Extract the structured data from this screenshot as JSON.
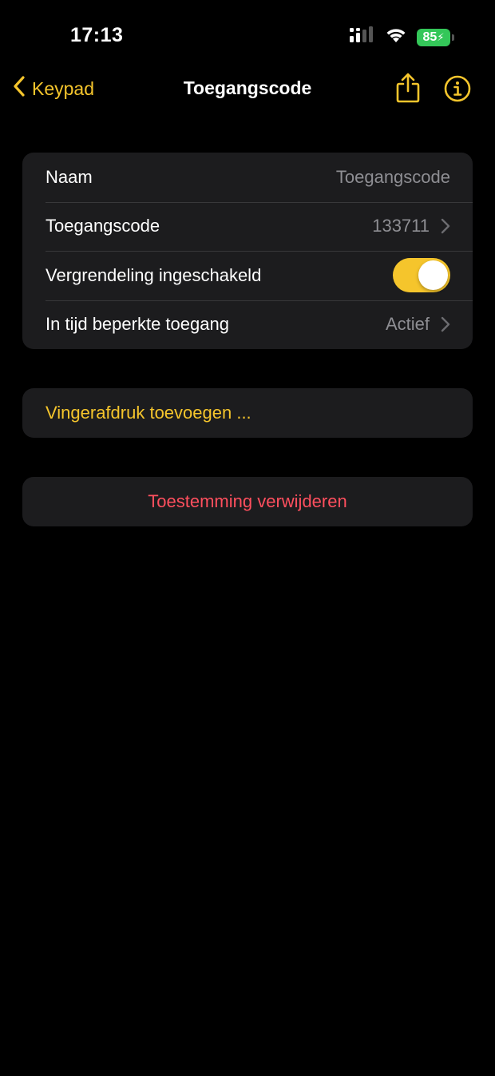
{
  "status_bar": {
    "time": "17:13",
    "battery_level": "85"
  },
  "nav": {
    "back_label": "Keypad",
    "title": "Toegangscode",
    "icons": [
      "chevron-left-icon",
      "share-icon",
      "info-icon"
    ]
  },
  "settings": {
    "rows": [
      {
        "label": "Naam",
        "value": "Toegangscode"
      },
      {
        "label": "Toegangscode",
        "value": "133711"
      },
      {
        "label": "Vergrendeling ingeschakeld",
        "toggle_on": true
      },
      {
        "label": "In tijd beperkte toegang",
        "value": "Actief"
      }
    ]
  },
  "actions": {
    "add_fingerprint": "Vingerafdruk toevoegen ...",
    "remove_permission": "Toestemming verwijderen"
  },
  "colors": {
    "accent": "#f5c52c",
    "destructive": "#ff4f5e",
    "battery": "#34c759",
    "cell_background": "#1c1c1e"
  }
}
